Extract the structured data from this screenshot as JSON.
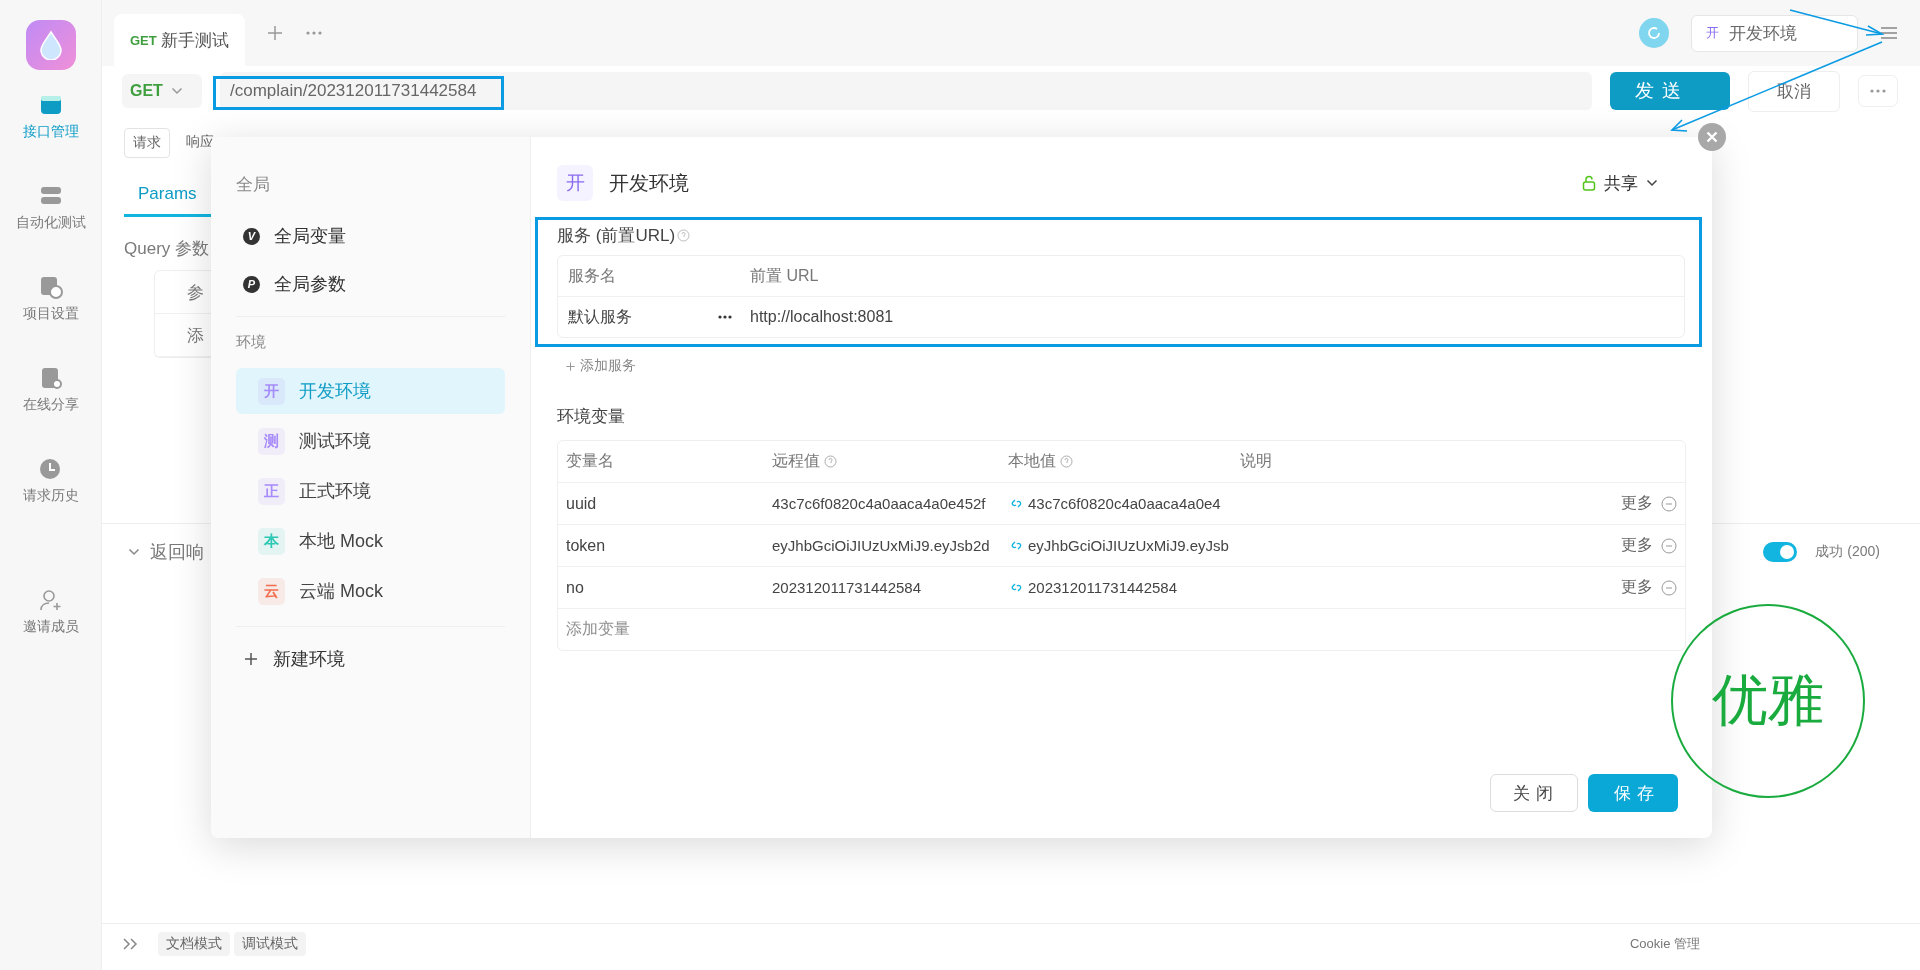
{
  "sidebar": {
    "items": [
      {
        "label": "接口管理",
        "selected": true
      },
      {
        "label": "自动化测试",
        "selected": false
      },
      {
        "label": "项目设置",
        "selected": false
      },
      {
        "label": "在线分享",
        "selected": false
      },
      {
        "label": "请求历史",
        "selected": false
      },
      {
        "label": "邀请成员",
        "selected": false
      }
    ]
  },
  "tab": {
    "method": "GET",
    "title": "新手测试"
  },
  "env_select": {
    "badge": "开",
    "label": "开发环境"
  },
  "url_bar": {
    "method": "GET",
    "url": "/complain/202312011731442584",
    "send": "发送",
    "cancel": "取消"
  },
  "request_tabs": [
    {
      "label": "请求",
      "selected": true
    },
    {
      "label": "响应",
      "selected": false
    }
  ],
  "params_tab": "Params",
  "query_label": "Query 参数",
  "param_table": {
    "header": "参",
    "add_row": "添"
  },
  "response": {
    "label": "返回响",
    "toggle_on": true,
    "status": "成功 (200)"
  },
  "bottom_bar": {
    "modes": [
      {
        "label": "文档模式",
        "selected": false
      },
      {
        "label": "调试模式",
        "selected": false
      }
    ],
    "cookie": "Cookie 管理"
  },
  "modal": {
    "global": {
      "heading": "全局",
      "items": [
        {
          "badge": "V",
          "label": "全局变量"
        },
        {
          "badge": "P",
          "label": "全局参数"
        }
      ]
    },
    "environments": {
      "heading": "环境",
      "items": [
        {
          "badge": "开",
          "label": "开发环境",
          "color": "#a78bfa",
          "selected": true
        },
        {
          "badge": "测",
          "label": "测试环境",
          "color": "#a78bfa",
          "selected": false
        },
        {
          "badge": "正",
          "label": "正式环境",
          "color": "#a78bfa",
          "selected": false
        },
        {
          "badge": "本",
          "label": "本地 Mock",
          "color": "#2dc7b5",
          "selected": false
        },
        {
          "badge": "云",
          "label": "云端 Mock",
          "color": "#f0704f",
          "selected": false
        }
      ],
      "new": "新建环境"
    },
    "detail": {
      "badge": "开",
      "title": "开发环境",
      "share": "共享",
      "services": {
        "heading": "服务 (前置URL)",
        "columns": [
          "服务名",
          "前置 URL"
        ],
        "rows": [
          {
            "name": "默认服务",
            "url": "http://localhost:8081"
          }
        ],
        "add": "添加服务"
      },
      "variables": {
        "heading": "环境变量",
        "columns": [
          {
            "label": "变量名",
            "help": false
          },
          {
            "label": "远程值",
            "help": true
          },
          {
            "label": "本地值",
            "help": true
          },
          {
            "label": "说明",
            "help": false
          }
        ],
        "rows": [
          {
            "name": "uuid",
            "remote": "43c7c6f0820c4a0aaca4a0e452f",
            "local": "43c7c6f0820c4a0aaca4a0e4",
            "more": "更多"
          },
          {
            "name": "token",
            "remote": "eyJhbGciOiJIUzUxMiJ9.eyJsb2d",
            "local": "eyJhbGciOiJIUzUxMiJ9.eyJsb",
            "more": "更多"
          },
          {
            "name": "no",
            "remote": "202312011731442584",
            "local": "202312011731442584",
            "more": "更多"
          }
        ],
        "add": "添加变量"
      }
    },
    "buttons": {
      "close": "关闭",
      "save": "保存"
    }
  },
  "annotation": {
    "stamp": "优雅"
  }
}
